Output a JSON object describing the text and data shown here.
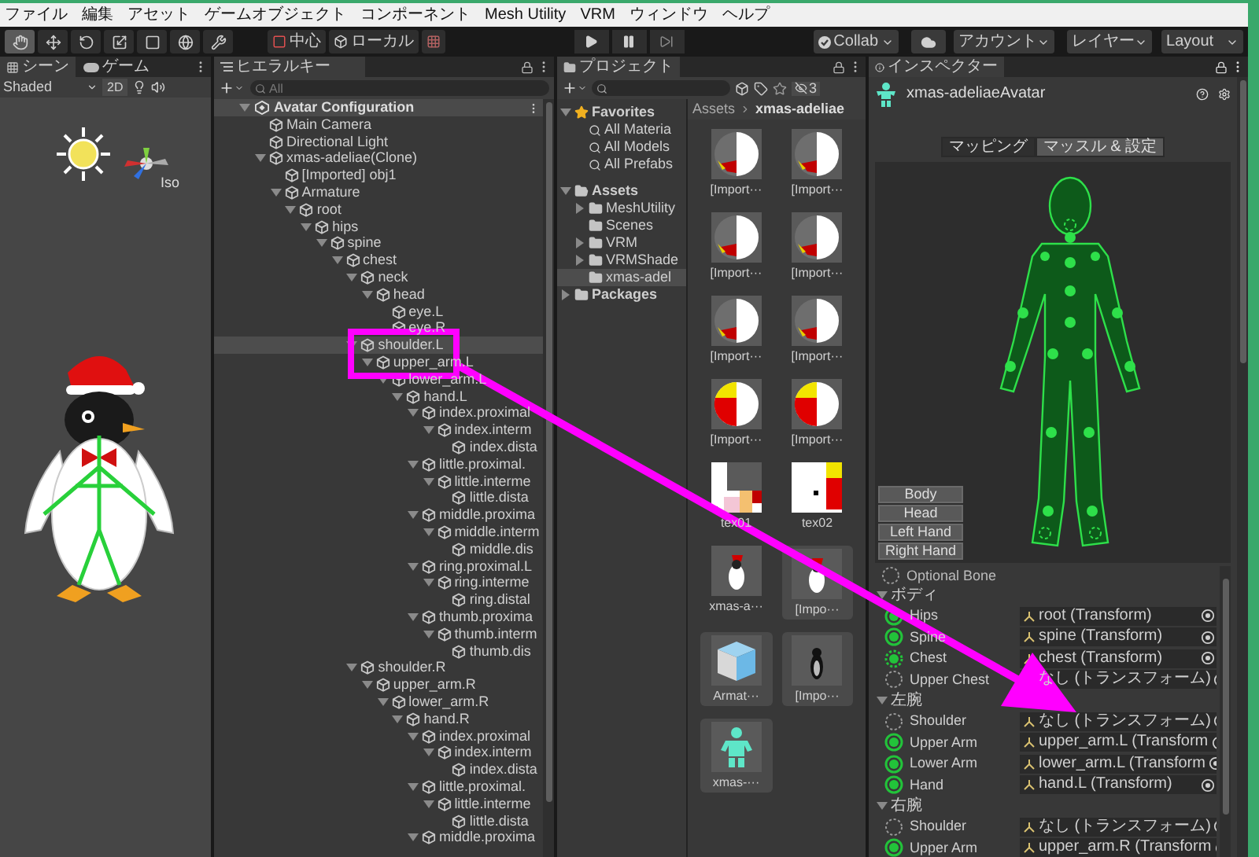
{
  "menu": [
    "ファイル",
    "編集",
    "アセット",
    "ゲームオブジェクト",
    "コンポーネント",
    "Mesh Utility",
    "VRM",
    "ウィンドウ",
    "ヘルプ"
  ],
  "toolbar": {
    "tools": [
      {
        "kind": "hand",
        "selected": true
      },
      {
        "kind": "move",
        "selected": false
      },
      {
        "kind": "rotate",
        "selected": false
      },
      {
        "kind": "scale",
        "selected": false
      },
      {
        "kind": "rect",
        "selected": false
      },
      {
        "kind": "transform",
        "selected": false
      },
      {
        "kind": "custom",
        "selected": false
      }
    ],
    "pivot": "中心",
    "space": "ローカル",
    "collab": "Collab",
    "account": "アカウント",
    "layers": "レイヤー",
    "layout": "Layout"
  },
  "scene": {
    "tabs": [
      {
        "label": "シーン",
        "selected": true
      },
      {
        "label": "ゲーム",
        "selected": false
      }
    ],
    "shading": "Shaded",
    "mode_2d": "2D",
    "gizmo_label": "Iso"
  },
  "hierarchy": {
    "tab": "ヒエラルキー",
    "search": {
      "placeholder": "All"
    },
    "scene_name": "Avatar Configuration",
    "items": [
      {
        "label": "Main Camera",
        "selected": false
      },
      {
        "label": "Directional Light",
        "selected": false
      },
      {
        "label": "xmas-adeliae(Clone)",
        "selected": false,
        "expanded": true,
        "children": [
          {
            "label": "[Imported] obj1",
            "selected": false
          },
          {
            "label": "Armature",
            "selected": false,
            "expanded": true,
            "children": [
              {
                "label": "root",
                "selected": false,
                "expanded": true,
                "children": [
                  {
                    "label": "hips",
                    "selected": false,
                    "expanded": true,
                    "children": [
                      {
                        "label": "spine",
                        "selected": false,
                        "expanded": true,
                        "children": [
                          {
                            "label": "chest",
                            "selected": false,
                            "expanded": true,
                            "children": [
                              {
                                "label": "neck",
                                "selected": false,
                                "expanded": true,
                                "children": [
                                  {
                                    "label": "head",
                                    "selected": false,
                                    "expanded": true,
                                    "children": [
                                      {
                                        "label": "eye.L",
                                        "selected": false
                                      },
                                      {
                                        "label": "eye.R",
                                        "selected": false
                                      }
                                    ]
                                  }
                                ]
                              },
                              {
                                "label": "shoulder.L",
                                "selected": true,
                                "expanded": true,
                                "children": [
                                  {
                                    "label": "upper_arm.L",
                                    "selected": false,
                                    "expanded": true,
                                    "children": [
                                      {
                                        "label": "lower_arm.L",
                                        "selected": false,
                                        "expanded": true,
                                        "children": [
                                          {
                                            "label": "hand.L",
                                            "selected": false,
                                            "expanded": true,
                                            "children": [
                                              {
                                                "label": "index.proximal",
                                                "selected": false,
                                                "expanded": true,
                                                "children": [
                                                  {
                                                    "label": "index.interm",
                                                    "selected": false,
                                                    "expanded": true,
                                                    "children": [
                                                      {
                                                        "label": "index.dista",
                                                        "selected": false
                                                      }
                                                    ]
                                                  }
                                                ]
                                              },
                                              {
                                                "label": "little.proximal.",
                                                "selected": false,
                                                "expanded": true,
                                                "children": [
                                                  {
                                                    "label": "little.interme",
                                                    "selected": false,
                                                    "expanded": true,
                                                    "children": [
                                                      {
                                                        "label": "little.dista",
                                                        "selected": false
                                                      }
                                                    ]
                                                  }
                                                ]
                                              },
                                              {
                                                "label": "middle.proxima",
                                                "selected": false,
                                                "expanded": true,
                                                "children": [
                                                  {
                                                    "label": "middle.interm",
                                                    "selected": false,
                                                    "expanded": true,
                                                    "children": [
                                                      {
                                                        "label": "middle.dis",
                                                        "selected": false
                                                      }
                                                    ]
                                                  }
                                                ]
                                              },
                                              {
                                                "label": "ring.proximal.L",
                                                "selected": false,
                                                "expanded": true,
                                                "children": [
                                                  {
                                                    "label": "ring.interme",
                                                    "selected": false,
                                                    "expanded": true,
                                                    "children": [
                                                      {
                                                        "label": "ring.distal",
                                                        "selected": false
                                                      }
                                                    ]
                                                  }
                                                ]
                                              },
                                              {
                                                "label": "thumb.proxima",
                                                "selected": false,
                                                "expanded": true,
                                                "children": [
                                                  {
                                                    "label": "thumb.interm",
                                                    "selected": false,
                                                    "expanded": true,
                                                    "children": [
                                                      {
                                                        "label": "thumb.dis",
                                                        "selected": false
                                                      }
                                                    ]
                                                  }
                                                ]
                                              }
                                            ]
                                          }
                                        ]
                                      }
                                    ]
                                  }
                                ]
                              },
                              {
                                "label": "shoulder.R",
                                "selected": false,
                                "expanded": true,
                                "children": [
                                  {
                                    "label": "upper_arm.R",
                                    "selected": false,
                                    "expanded": true,
                                    "children": [
                                      {
                                        "label": "lower_arm.R",
                                        "selected": false,
                                        "expanded": true,
                                        "children": [
                                          {
                                            "label": "hand.R",
                                            "selected": false,
                                            "expanded": true,
                                            "children": [
                                              {
                                                "label": "index.proximal",
                                                "selected": false,
                                                "expanded": true,
                                                "children": [
                                                  {
                                                    "label": "index.interm",
                                                    "selected": false,
                                                    "expanded": true,
                                                    "children": [
                                                      {
                                                        "label": "index.dista",
                                                        "selected": false
                                                      }
                                                    ]
                                                  }
                                                ]
                                              },
                                              {
                                                "label": "little.proximal.",
                                                "selected": false,
                                                "expanded": true,
                                                "children": [
                                                  {
                                                    "label": "little.interme",
                                                    "selected": false,
                                                    "expanded": true,
                                                    "children": [
                                                      {
                                                        "label": "little.dista",
                                                        "selected": false
                                                      }
                                                    ]
                                                  }
                                                ]
                                              },
                                              {
                                                "label": "middle.proxima",
                                                "selected": false,
                                                "expanded": true
                                              }
                                            ]
                                          }
                                        ]
                                      }
                                    ]
                                  }
                                ]
                              }
                            ]
                          }
                        ]
                      }
                    ]
                  }
                ]
              }
            ]
          }
        ]
      }
    ]
  },
  "project": {
    "tab": "プロジェクト",
    "hidden_count": "3",
    "favorites": {
      "label": "Favorites",
      "items": [
        "All Materia",
        "All Models",
        "All Prefabs"
      ]
    },
    "folders": [
      {
        "label": "Assets",
        "expanded": true,
        "selected": false,
        "children": [
          {
            "label": "MeshUtility",
            "expanded": false,
            "selected": false
          },
          {
            "label": "Scenes",
            "selected": false
          },
          {
            "label": "VRM",
            "expanded": false,
            "selected": false
          },
          {
            "label": "VRMShade",
            "expanded": false,
            "selected": false
          },
          {
            "label": "xmas-adel",
            "selected": true
          }
        ]
      },
      {
        "label": "Packages",
        "expanded": false,
        "selected": false
      }
    ],
    "breadcrumb": [
      "Assets",
      "xmas-adeliae"
    ],
    "assets": [
      {
        "label": "[Import···",
        "kind": "material_dark"
      },
      {
        "label": "[Import···",
        "kind": "material_dark"
      },
      {
        "label": "[Import···",
        "kind": "material_dark"
      },
      {
        "label": "[Import···",
        "kind": "material_dark"
      },
      {
        "label": "[Import···",
        "kind": "material_dark"
      },
      {
        "label": "[Import···",
        "kind": "material_dark"
      },
      {
        "label": "[Import···",
        "kind": "material_red"
      },
      {
        "label": "[Import···",
        "kind": "material_red"
      },
      {
        "label": "tex01",
        "kind": "texture_a"
      },
      {
        "label": "tex02",
        "kind": "texture_b"
      },
      {
        "label": "xmas-a···",
        "kind": "prefab"
      },
      {
        "label": "[Impo···",
        "kind": "prefab_child"
      },
      {
        "label": "Armat···",
        "kind": "mesh"
      },
      {
        "label": "[Impo···",
        "kind": "model_child"
      },
      {
        "label": "xmas-···",
        "kind": "avatar"
      }
    ]
  },
  "inspector": {
    "tab": "インスペクター",
    "object_name": "xmas-adeliaeAvatar",
    "tabs": [
      {
        "label": "マッピング",
        "selected": true
      },
      {
        "label": "マッスル & 設定",
        "selected": false
      }
    ],
    "body_parts": [
      "Body",
      "Head",
      "Left Hand",
      "Right Hand"
    ],
    "legend": "Optional Bone",
    "groups": [
      {
        "label": "ボディ",
        "expanded": true,
        "bones": [
          {
            "label": "Hips",
            "optional": false,
            "assigned": true,
            "value": "root (Transform)"
          },
          {
            "label": "Spine",
            "optional": false,
            "assigned": true,
            "value": "spine (Transform)"
          },
          {
            "label": "Chest",
            "optional": true,
            "assigned": true,
            "value": "chest (Transform)"
          },
          {
            "label": "Upper Chest",
            "optional": true,
            "assigned": false,
            "value": "なし (トランスフォーム)"
          }
        ]
      },
      {
        "label": "左腕",
        "expanded": true,
        "bones": [
          {
            "label": "Shoulder",
            "optional": true,
            "assigned": false,
            "value": "なし (トランスフォーム)"
          },
          {
            "label": "Upper Arm",
            "optional": false,
            "assigned": true,
            "value": "upper_arm.L (Transform"
          },
          {
            "label": "Lower Arm",
            "optional": false,
            "assigned": true,
            "value": "lower_arm.L (Transform"
          },
          {
            "label": "Hand",
            "optional": false,
            "assigned": true,
            "value": "hand.L (Transform)"
          }
        ]
      },
      {
        "label": "右腕",
        "expanded": true,
        "bones": [
          {
            "label": "Shoulder",
            "optional": true,
            "assigned": false,
            "value": "なし (トランスフォーム)"
          },
          {
            "label": "Upper Arm",
            "optional": false,
            "assigned": true,
            "value": "upper_arm.R (Transform"
          }
        ]
      }
    ]
  }
}
